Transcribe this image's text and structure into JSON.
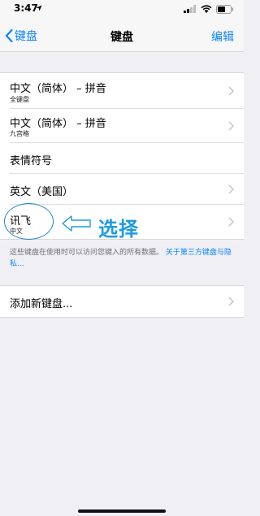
{
  "status_bar": {
    "time": "3:47",
    "icons": [
      "location-arrow-icon",
      "signal-icon",
      "wifi-icon",
      "battery-icon"
    ]
  },
  "nav": {
    "back_label": "键盘",
    "title": "键盘",
    "edit_label": "编辑"
  },
  "keyboards": [
    {
      "title": "中文（简体） – 拼音",
      "subtitle": "全键盘"
    },
    {
      "title": "中文（简体） – 拼音",
      "subtitle": "九宫格"
    },
    {
      "title": "表情符号",
      "subtitle": ""
    },
    {
      "title": "英文（美国）",
      "subtitle": ""
    },
    {
      "title": "讯飞",
      "subtitle": "中文"
    }
  ],
  "footer_note": {
    "text": "这些键盘在使用时可以访问您键入的所有数据。",
    "link": "关于第三方键盘与隐私..."
  },
  "add_keyboard_label": "添加新键盘...",
  "annotation": {
    "text": "选择"
  },
  "colors": {
    "accent": "#0a84ff",
    "annotation": "#1e9be0",
    "background": "#efeff4"
  }
}
